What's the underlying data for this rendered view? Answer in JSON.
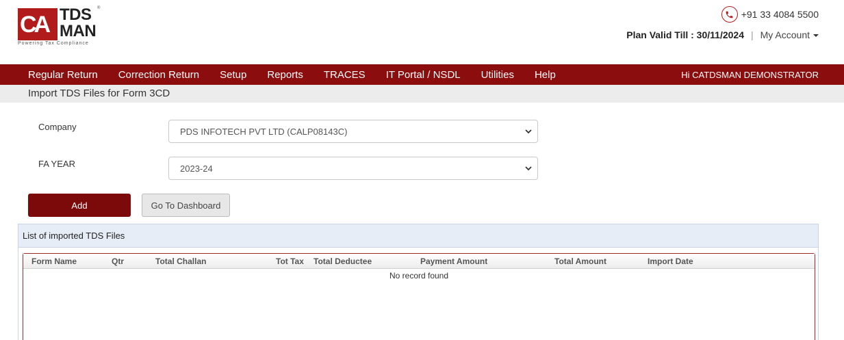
{
  "brand": {
    "logo_mark": "CA",
    "logo_line1": "TDS",
    "logo_line2": "MAN",
    "registered": "®",
    "tagline": "Powering Tax Compliance",
    "accent_color": "#8c0d0d"
  },
  "header": {
    "phone": "+91 33 4084 5500",
    "plan_valid": "Plan Valid Till : 30/11/2024",
    "separator": "|",
    "my_account": "My Account"
  },
  "nav": {
    "items": [
      "Regular Return",
      "Correction Return",
      "Setup",
      "Reports",
      "TRACES",
      "IT Portal / NSDL",
      "Utilities",
      "Help"
    ],
    "user_greeting": "Hi CATDSMAN DEMONSTRATOR"
  },
  "page": {
    "title": "Import TDS Files for Form 3CD"
  },
  "form": {
    "company_label": "Company",
    "company_value": "PDS INFOTECH PVT LTD (CALP08143C)",
    "fa_year_label": "FA YEAR",
    "fa_year_value": "2023-24",
    "add_label": "Add",
    "dashboard_label": "Go To Dashboard"
  },
  "panel": {
    "title": "List of imported TDS Files",
    "columns": [
      "Form Name",
      "Qtr",
      "Total Challan",
      "Tot Tax",
      "Total Deductee",
      "Payment Amount",
      "Total Amount",
      "Import Date"
    ],
    "empty_message": "No record found"
  }
}
